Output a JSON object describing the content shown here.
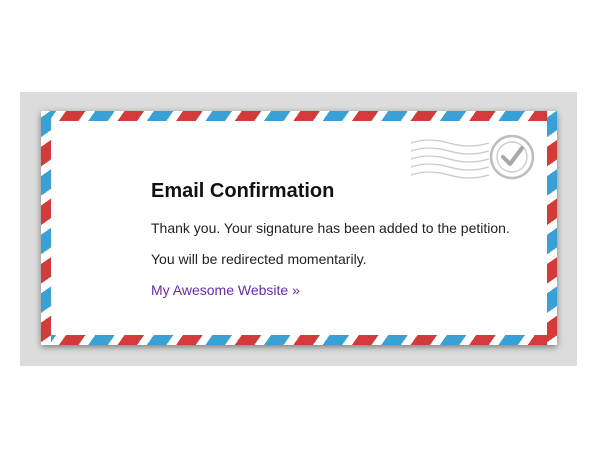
{
  "confirmation": {
    "title": "Email Confirmation",
    "message": "Thank you. Your signature has been added to the petition.",
    "redirect_notice": "You will be redirected momentarily.",
    "site_link_label": "My Awesome Website »"
  },
  "icons": {
    "postmark": "postmark-check-icon"
  },
  "colors": {
    "stripe_red": "#d33b3b",
    "stripe_blue": "#3aa1d6",
    "link": "#6a2bb0",
    "backdrop": "#dcdcdc"
  }
}
